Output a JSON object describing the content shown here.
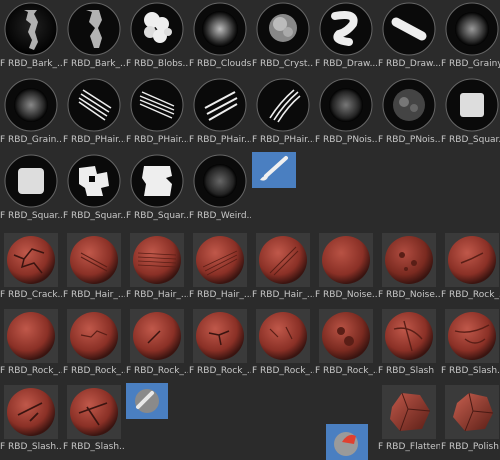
{
  "brush_grid": {
    "alpha_brushes": [
      {
        "label": "F RBD_Bark_...",
        "icon": "bark-alpha"
      },
      {
        "label": "F RBD_Bark_...",
        "icon": "bark-alpha-2"
      },
      {
        "label": "F RBD_Blobs...",
        "icon": "blobs-alpha"
      },
      {
        "label": "F RBD_Clouds",
        "icon": "clouds-alpha"
      },
      {
        "label": "F RBD_Cryst...",
        "icon": "crystal-alpha"
      },
      {
        "label": "F RBD_Draw...",
        "icon": "draw-s-alpha"
      },
      {
        "label": "F RBD_Draw...",
        "icon": "draw-stroke-alpha"
      },
      {
        "label": "F RBD_Grainy",
        "icon": "grainy-alpha"
      },
      {
        "label": "F RBD_Grain...",
        "icon": "grain-alpha"
      },
      {
        "label": "F RBD_PHair...",
        "icon": "phair-alpha-1"
      },
      {
        "label": "F RBD_PHair...",
        "icon": "phair-alpha-2"
      },
      {
        "label": "F RBD_PHair...",
        "icon": "phair-alpha-3"
      },
      {
        "label": "F RBD_PHair...",
        "icon": "phair-alpha-4"
      },
      {
        "label": "F RBD_PNois...",
        "icon": "pnoise-alpha-1"
      },
      {
        "label": "F RBD_PNois...",
        "icon": "pnoise-alpha-2"
      },
      {
        "label": "F RBD_Squar...",
        "icon": "square-alpha-1"
      },
      {
        "label": "F RBD_Squar...",
        "icon": "square-alpha-2"
      },
      {
        "label": "F RBD_Squar...",
        "icon": "square-alpha-3"
      },
      {
        "label": "F RBD_Squar...",
        "icon": "square-alpha-4"
      },
      {
        "label": "F RBD_Weird...",
        "icon": "weird-alpha"
      }
    ],
    "sculpt_brushes": [
      {
        "label": "F RBD_Crack...",
        "icon": "crack-sphere"
      },
      {
        "label": "F RBD_Hair_...",
        "icon": "hair-sphere-1"
      },
      {
        "label": "F RBD_Hair_...",
        "icon": "hair-sphere-2"
      },
      {
        "label": "F RBD_Hair_...",
        "icon": "hair-sphere-3"
      },
      {
        "label": "F RBD_Hair_...",
        "icon": "hair-sphere-4"
      },
      {
        "label": "F RBD_Noise...",
        "icon": "noise-sphere-1"
      },
      {
        "label": "F RBD_Noise...",
        "icon": "noise-sphere-2"
      },
      {
        "label": "F RBD_Rock_...",
        "icon": "rock-sphere-1"
      },
      {
        "label": "F RBD_Rock_...",
        "icon": "rock-sphere-2"
      },
      {
        "label": "F RBD_Rock_...",
        "icon": "rock-sphere-3"
      },
      {
        "label": "F RBD_Rock_...",
        "icon": "rock-sphere-4"
      },
      {
        "label": "F RBD_Rock_...",
        "icon": "rock-sphere-5"
      },
      {
        "label": "F RBD_Rock_...",
        "icon": "rock-sphere-6"
      },
      {
        "label": "F RBD_Rock_...",
        "icon": "rock-sphere-7"
      },
      {
        "label": "F RBD_Slash",
        "icon": "slash-sphere"
      },
      {
        "label": "F RBD_Slash...",
        "icon": "slash-sphere-2"
      },
      {
        "label": "F RBD_Slash...",
        "icon": "slash-sphere-3"
      },
      {
        "label": "F RBD_Slash...",
        "icon": "slash-sphere-4"
      },
      {
        "label": "F RBD_Flatten",
        "icon": "flatten-rock"
      },
      {
        "label": "F RBD_Polish",
        "icon": "polish-rock"
      }
    ]
  },
  "colors": {
    "background": "#2b2b2b",
    "label": "#c8c8c8",
    "tool_icon_bg": "#4a7fc1",
    "sphere_base": "#8a3026"
  }
}
